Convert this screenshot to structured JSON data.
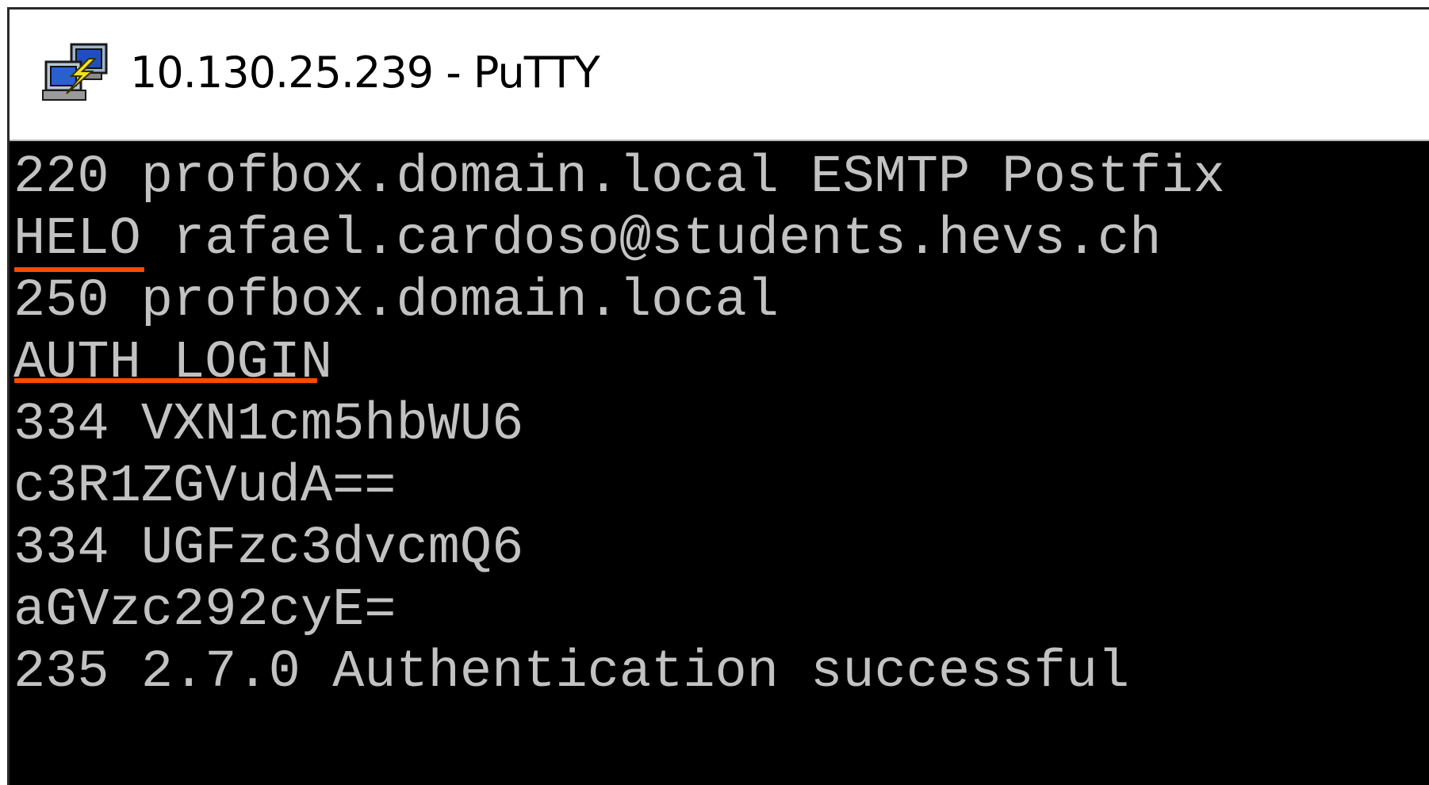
{
  "window": {
    "title": "10.130.25.239 - PuTTY",
    "icon": "putty-icon"
  },
  "terminal": {
    "lines": [
      "220 profbox.domain.local ESMTP Postfix",
      "HELO rafael.cardoso@students.hevs.ch",
      "250 profbox.domain.local",
      "AUTH LOGIN",
      "334 VXN1cm5hbWU6",
      "c3R1ZGVudA==",
      "334 UGFzc3dvcmQ6",
      "aGVzc292cyE=",
      "235 2.7.0 Authentication successful"
    ],
    "text_color": "#c2c2c2",
    "background": "#000000",
    "highlight_color": "#ff4a00"
  }
}
